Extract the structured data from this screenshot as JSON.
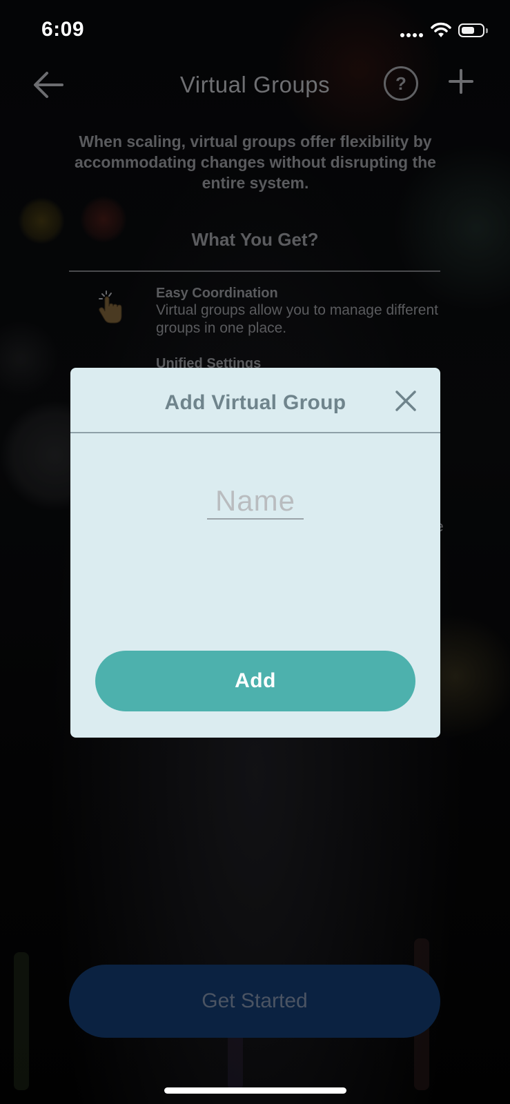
{
  "status_bar": {
    "time": "6:09"
  },
  "header": {
    "title": "Virtual Groups",
    "help_label": "?"
  },
  "content": {
    "intro": "When scaling, virtual groups offer flexibility by accommodating changes without disrupting the entire system.",
    "section_title": "What You Get?",
    "features": [
      {
        "title": "Easy Coordination",
        "description": "Virtual groups allow you to manage different groups in one place.",
        "icon": "pointing-hand-icon"
      },
      {
        "title": "Unified Settings",
        "description": ""
      }
    ],
    "partial_text": "re",
    "cta_label": "Get Started"
  },
  "modal": {
    "title": "Add Virtual Group",
    "name_placeholder": "Name",
    "submit_label": "Add"
  },
  "colors": {
    "modal_bg": "#dbecf0",
    "modal_title": "#6f848c",
    "accent": "#4db1ad",
    "cta_bg": "#0b2241"
  }
}
